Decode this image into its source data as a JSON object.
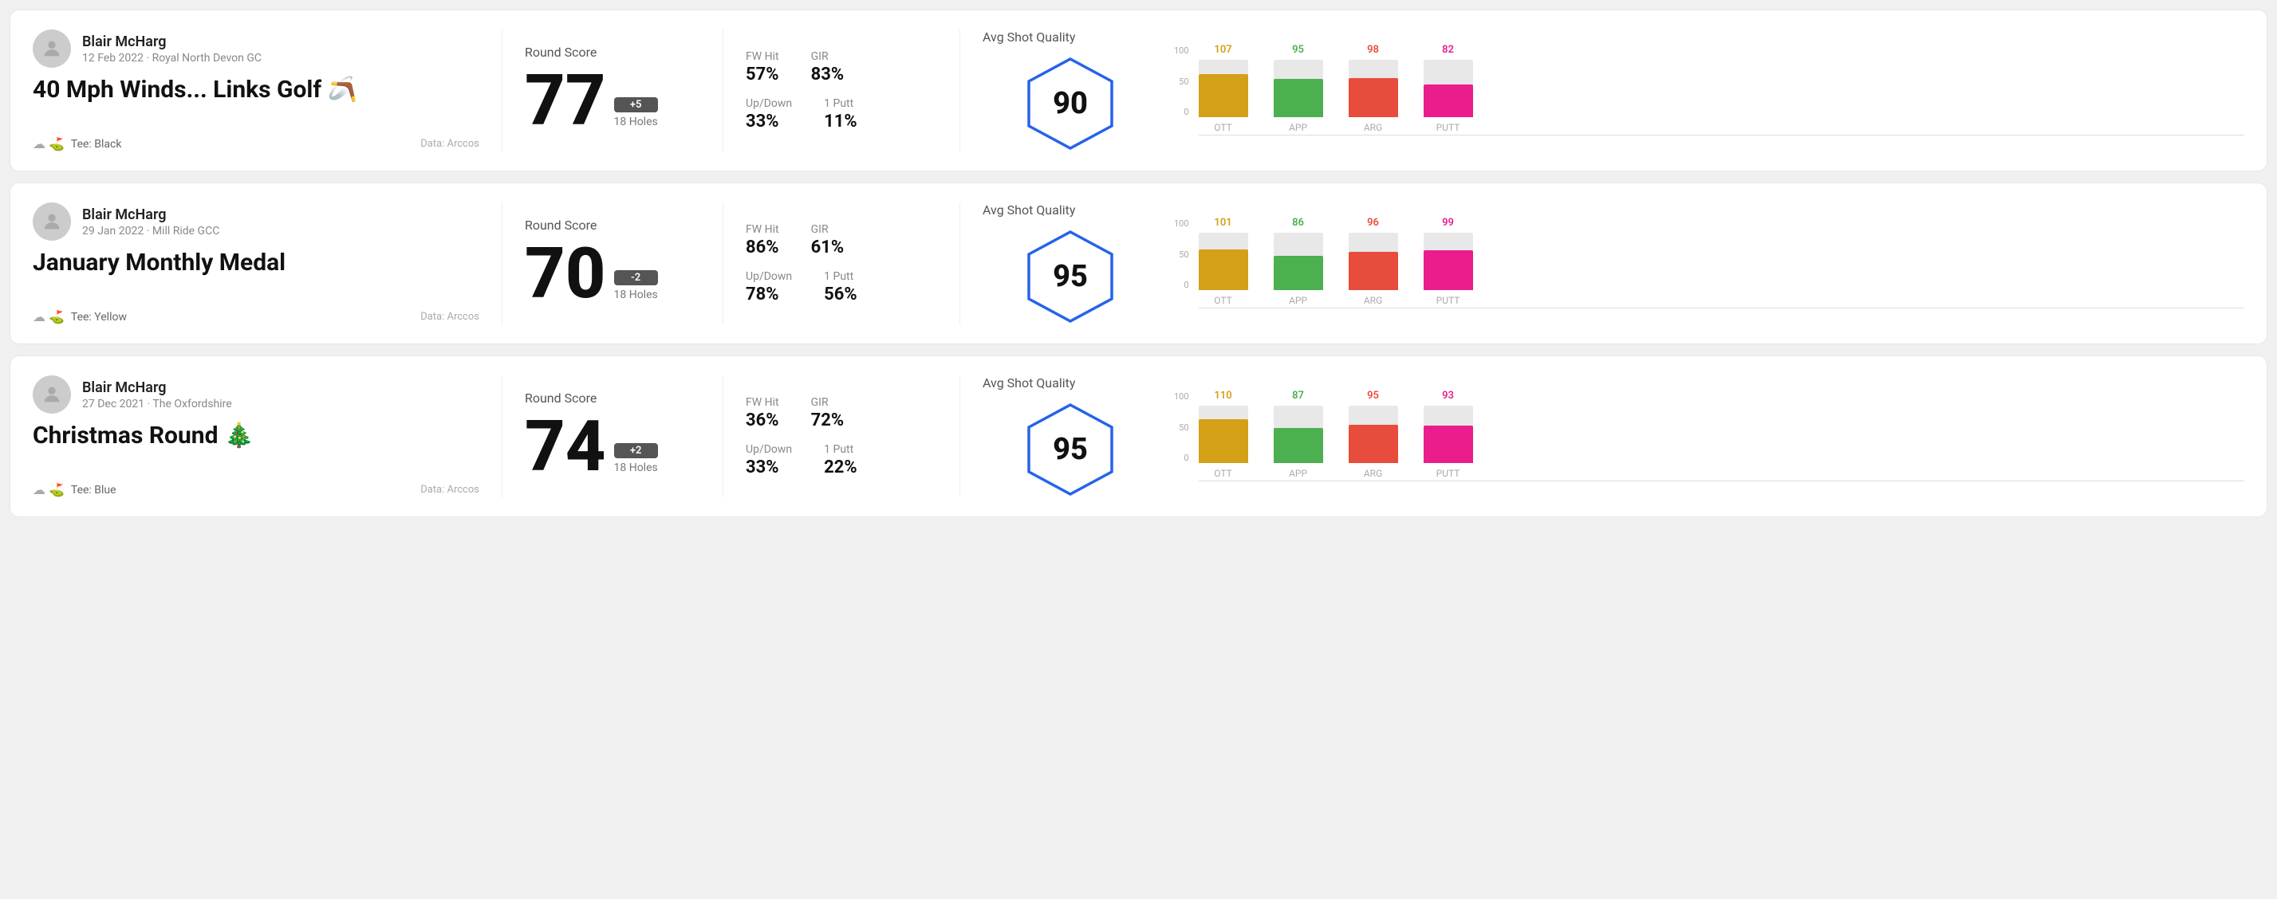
{
  "rounds": [
    {
      "id": "round-1",
      "user_name": "Blair McHarg",
      "date_course": "12 Feb 2022 · Royal North Devon GC",
      "title": "40 Mph Winds... Links Golf 🪃",
      "tee": "Tee: Black",
      "data_source": "Data: Arccos",
      "round_score_label": "Round Score",
      "score": "77",
      "score_diff": "+5",
      "holes": "18 Holes",
      "fw_hit_label": "FW Hit",
      "fw_hit_value": "57%",
      "gir_label": "GIR",
      "gir_value": "83%",
      "updown_label": "Up/Down",
      "updown_value": "33%",
      "one_putt_label": "1 Putt",
      "one_putt_value": "11%",
      "avg_shot_quality_label": "Avg Shot Quality",
      "quality_score": "90",
      "chart": {
        "y_labels": [
          "100",
          "50",
          "0"
        ],
        "bars": [
          {
            "label": "OTT",
            "value": 107,
            "height_pct": 75,
            "color_class": "ott-bar",
            "value_color": "ott-color"
          },
          {
            "label": "APP",
            "value": 95,
            "height_pct": 66,
            "color_class": "app-bar",
            "value_color": "app-color"
          },
          {
            "label": "ARG",
            "value": 98,
            "height_pct": 68,
            "color_class": "arg-bar",
            "value_color": "arg-color"
          },
          {
            "label": "PUTT",
            "value": 82,
            "height_pct": 57,
            "color_class": "putt-bar",
            "value_color": "putt-color"
          }
        ]
      }
    },
    {
      "id": "round-2",
      "user_name": "Blair McHarg",
      "date_course": "29 Jan 2022 · Mill Ride GCC",
      "title": "January Monthly Medal",
      "tee": "Tee: Yellow",
      "data_source": "Data: Arccos",
      "round_score_label": "Round Score",
      "score": "70",
      "score_diff": "-2",
      "holes": "18 Holes",
      "fw_hit_label": "FW Hit",
      "fw_hit_value": "86%",
      "gir_label": "GIR",
      "gir_value": "61%",
      "updown_label": "Up/Down",
      "updown_value": "78%",
      "one_putt_label": "1 Putt",
      "one_putt_value": "56%",
      "avg_shot_quality_label": "Avg Shot Quality",
      "quality_score": "95",
      "chart": {
        "y_labels": [
          "100",
          "50",
          "0"
        ],
        "bars": [
          {
            "label": "OTT",
            "value": 101,
            "height_pct": 71,
            "color_class": "ott-bar",
            "value_color": "ott-color"
          },
          {
            "label": "APP",
            "value": 86,
            "height_pct": 60,
            "color_class": "app-bar",
            "value_color": "app-color"
          },
          {
            "label": "ARG",
            "value": 96,
            "height_pct": 67,
            "color_class": "arg-bar",
            "value_color": "arg-color"
          },
          {
            "label": "PUTT",
            "value": 99,
            "height_pct": 69,
            "color_class": "putt-bar",
            "value_color": "putt-color"
          }
        ]
      }
    },
    {
      "id": "round-3",
      "user_name": "Blair McHarg",
      "date_course": "27 Dec 2021 · The Oxfordshire",
      "title": "Christmas Round 🎄",
      "tee": "Tee: Blue",
      "data_source": "Data: Arccos",
      "round_score_label": "Round Score",
      "score": "74",
      "score_diff": "+2",
      "holes": "18 Holes",
      "fw_hit_label": "FW Hit",
      "fw_hit_value": "36%",
      "gir_label": "GIR",
      "gir_value": "72%",
      "updown_label": "Up/Down",
      "updown_value": "33%",
      "one_putt_label": "1 Putt",
      "one_putt_value": "22%",
      "avg_shot_quality_label": "Avg Shot Quality",
      "quality_score": "95",
      "chart": {
        "y_labels": [
          "100",
          "50",
          "0"
        ],
        "bars": [
          {
            "label": "OTT",
            "value": 110,
            "height_pct": 77,
            "color_class": "ott-bar",
            "value_color": "ott-color"
          },
          {
            "label": "APP",
            "value": 87,
            "height_pct": 61,
            "color_class": "app-bar",
            "value_color": "app-color"
          },
          {
            "label": "ARG",
            "value": 95,
            "height_pct": 66,
            "color_class": "arg-bar",
            "value_color": "arg-color"
          },
          {
            "label": "PUTT",
            "value": 93,
            "height_pct": 65,
            "color_class": "putt-bar",
            "value_color": "putt-color"
          }
        ]
      }
    }
  ]
}
